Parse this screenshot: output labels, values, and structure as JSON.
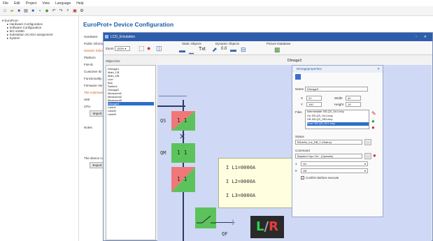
{
  "menu": [
    "File",
    "Edit",
    "Project",
    "View",
    "Language",
    "Help"
  ],
  "toolbar_icons": [
    "new",
    "open",
    "save",
    "print",
    "cut",
    "copy",
    "paste",
    "undo",
    "redo",
    "find",
    "zoom",
    "settings"
  ],
  "tree": {
    "root": "EuroProt+",
    "items": [
      "Hardware Configuration",
      "Software Configuration",
      "IEC 61850",
      "Substation SCADA assignment",
      "System"
    ]
  },
  "device": {
    "title": "EuroProt+ Device Configuration",
    "labels": [
      "Hardware",
      "Public informa",
      "Generic informa",
      "Platform",
      "FW-ID",
      "Customer ID",
      "Functionality se",
      "Firmware Vers",
      "The minimum ver",
      "HMI",
      "CPU"
    ],
    "import_button": "Import",
    "notes_label": "Notes",
    "status_label": "The device con",
    "export_button": "Export"
  },
  "dialog": {
    "title": "LCD_Emulation",
    "zoom_label": "Zoom",
    "zoom_value": "100%",
    "group_static": "Static Objects",
    "group_dynamic": "Dynamic Objects",
    "group_picture": "Picture Database",
    "objlist_label": "Object list:",
    "objects": [
      "DImage1",
      "Main_CB",
      "Main_DB",
      "Line",
      "Bus",
      "Switch1",
      "DImage2",
      "Measured1",
      "Measured2",
      "Measured3",
      "DImage3",
      "Label1",
      "Label2",
      "Label3"
    ],
    "selected_object": "DImage3",
    "canvas_title": "DImage3"
  },
  "diagram": {
    "label_qs": "QS",
    "label_qm": "QM",
    "label_qf": "QF",
    "cell_values": [
      "1 1",
      "1 1",
      "1 1"
    ],
    "meas_lines": [
      "I L1=0000A",
      "I L2=0000A",
      "I L3=0000A"
    ],
    "lr_l": "L",
    "lr_sep": "/",
    "lr_r": "R"
  },
  "props": {
    "title": "DImageproperties",
    "name_label": "Name",
    "name_value": "DImage3",
    "x_label": "X",
    "x_value": "21",
    "y_label": "Y",
    "y_value": "190",
    "width_label": "Width",
    "width_value": "42",
    "height_label": "Height",
    "height_value": "19",
    "files_label": "Files",
    "files": [
      "Intermediate: BS-QS_On1.bmp",
      "On: BS-QS_On1.bmp",
      "Off: BS-QS_Off1.bmp",
      "Error: BS-QS_Err1.bmp"
    ],
    "selected_file": "Error: BS-QS_Err1.bmp",
    "status_label": "Status",
    "status_value": "BSdefin_Ins_DB_1 (Status)",
    "command_label": "Command",
    "command_value": "Bayfarm Dpc Ctrl - (Operate)",
    "on_label": "1",
    "on_value": "On",
    "off_label": "0",
    "off_value": "Off",
    "confirm_label": "Confirm Before execute"
  },
  "colors": {
    "title_bar": "#2e5eab",
    "link_blue": "#1b5ea8",
    "canvas_bg": "#cfd9f5",
    "cell_green": "#5cc35c",
    "cell_red": "#f07878",
    "bus_dark": "#2b3a66",
    "led_green": "#2bd34b",
    "led_red": "#e83c3c"
  }
}
